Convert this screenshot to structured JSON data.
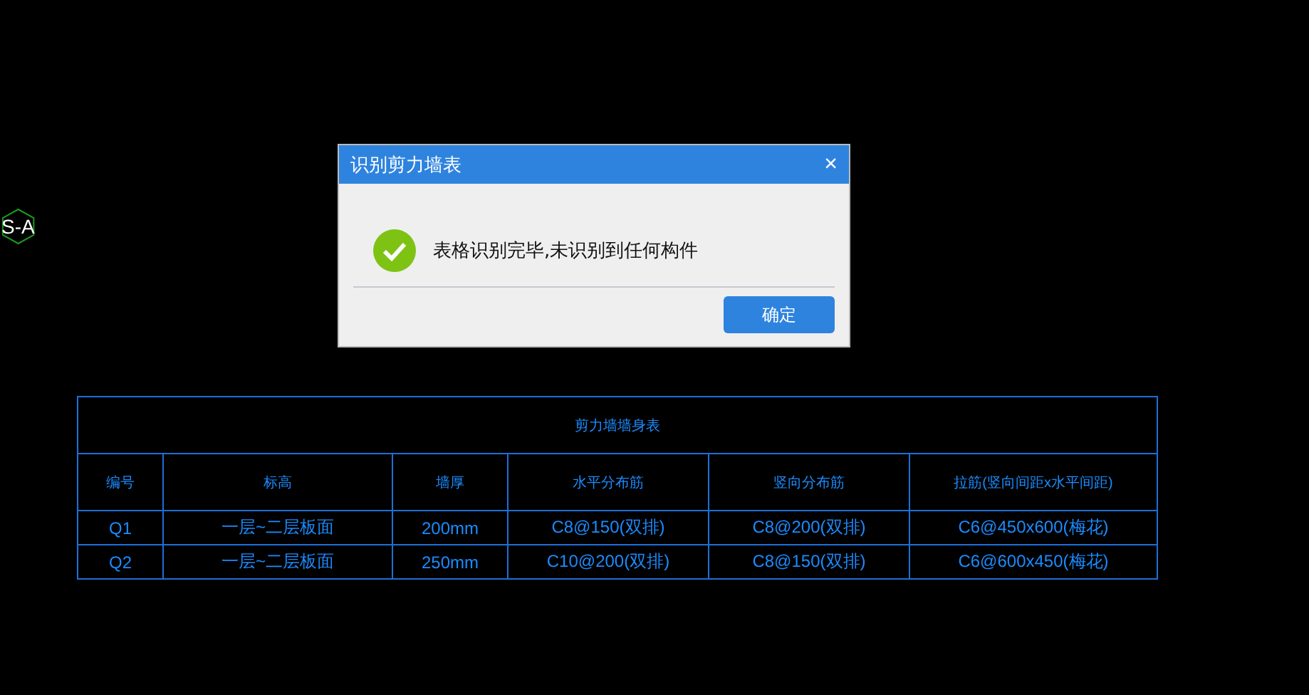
{
  "axis_marker": {
    "label": "S-A"
  },
  "dialog": {
    "title": "识别剪力墙表",
    "close": "×",
    "message": "表格识别完毕,未识别到任何构件",
    "buttons": [
      "确定"
    ]
  },
  "table": {
    "title": "剪力墙墙身表",
    "columns": [
      "编号",
      "标高",
      "墙厚",
      "水平分布筋",
      "竖向分布筋",
      "拉筋(竖向间距x水平间距)"
    ],
    "rows": [
      [
        "Q1",
        "一层~二层板面",
        "200mm",
        "C8@150(双排)",
        "C8@200(双排)",
        "C6@450x600(梅花)"
      ],
      [
        "Q2",
        "一层~二层板面",
        "250mm",
        "C10@200(双排)",
        "C8@150(双排)",
        "C6@600x450(梅花)"
      ]
    ]
  }
}
